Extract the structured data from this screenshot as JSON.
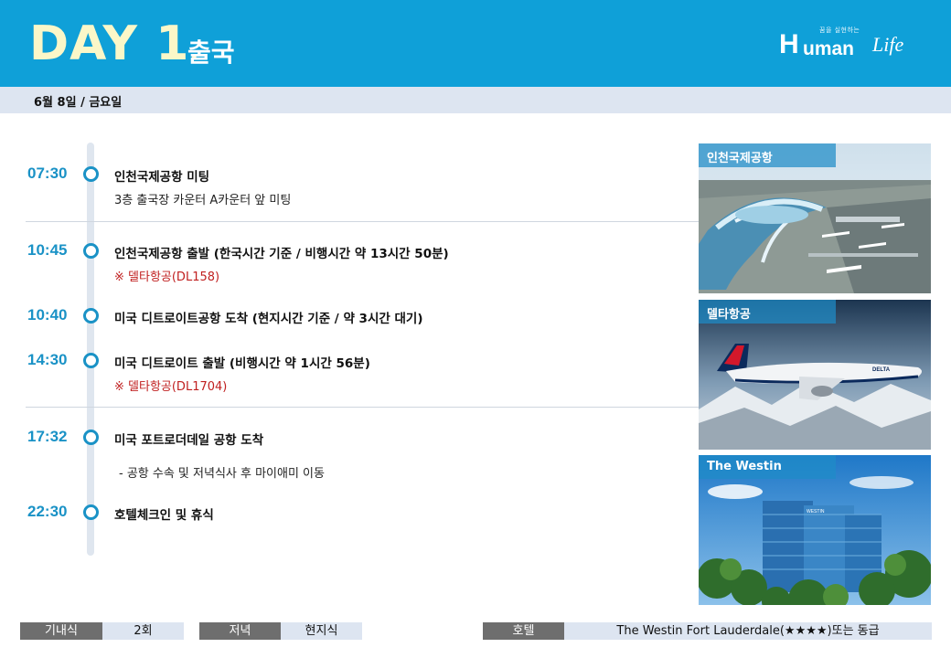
{
  "header": {
    "day_label": "DAY 1",
    "day_dot": ".",
    "subtitle": "출국",
    "logo": {
      "tagline": "꿈을 실현하는",
      "h": "H",
      "uman": "uman",
      "life": "Life"
    },
    "date": "6월 8일 / 금요일"
  },
  "schedule": [
    {
      "time": "07:30",
      "title": "인천국제공항 미팅",
      "detail": "3층 출국장 카운터 A카운터 앞 미팅"
    },
    {
      "time": "10:45",
      "title": "인천국제공항 출발 (한국시간 기준 / 비행시간 약 13시간 50분)",
      "detail": "※ 델타항공(DL158)"
    },
    {
      "time": "10:40",
      "title": "미국 디트로이트공항 도착 (현지시간 기준 / 약 3시간 대기)"
    },
    {
      "time": "14:30",
      "title": "미국 디트로이트 출발 (비행시간 약 1시간 56분)",
      "detail": "※ 델타항공(DL1704)"
    },
    {
      "time": "17:32",
      "title": "미국 포트로더데일 공항 도착",
      "detail": "- 공항 수속 및 저녁식사 후 마이애미 이동"
    },
    {
      "time": "22:30",
      "title": "호텔체크인 및 휴식"
    }
  ],
  "photos": [
    {
      "label": "인천국제공항"
    },
    {
      "label": "델타항공",
      "plane_text": "DELTA"
    },
    {
      "label": "The Westin",
      "building_text": "WESTIN"
    }
  ],
  "footer": {
    "meal_label": "기내식",
    "meal_value": "2회",
    "dinner_label": "저녁",
    "dinner_value": "현지식",
    "hotel_label": "호텔",
    "hotel_value": "The Westin Fort Lauderdale(★★★★)또는 동급"
  },
  "colors": {
    "header_bg": "#0fa0d8",
    "day_text": "#fbf7c8",
    "accent": "#1a92c6",
    "alert": "#c02020",
    "date_bar": "#dde5f1",
    "footer_dark": "#6e6e6e"
  }
}
